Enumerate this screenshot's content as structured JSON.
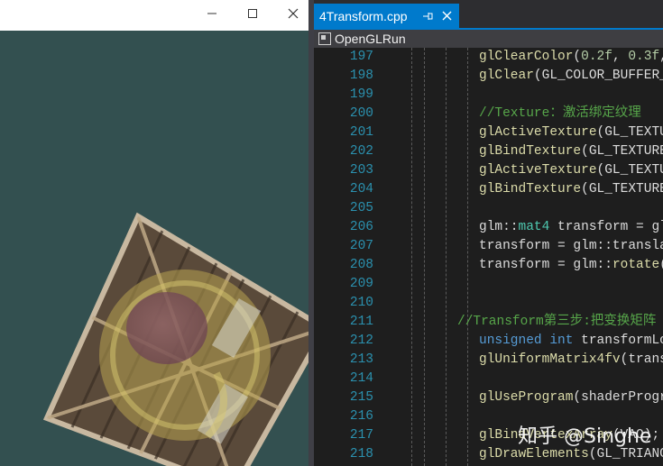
{
  "gl_window": {
    "title": "",
    "buttons": {
      "minimize": "—",
      "maximize": "☐",
      "close": "✕"
    },
    "background_color": "#335050"
  },
  "editor": {
    "tab": {
      "title": "4Transform.cpp",
      "pin": "⊸",
      "close": "✕"
    },
    "nav": {
      "project": "OpenGLRun"
    },
    "lines": [
      {
        "n": "197",
        "text": "glClearColor(0.2f, 0.3f,"
      },
      {
        "n": "198",
        "text": "glClear(GL_COLOR_BUFFER_"
      },
      {
        "n": "199",
        "text": ""
      },
      {
        "n": "200",
        "text": "//Texture：激活绑定纹理"
      },
      {
        "n": "201",
        "text": "glActiveTexture(GL_TEXTU"
      },
      {
        "n": "202",
        "text": "glBindTexture(GL_TEXTURE"
      },
      {
        "n": "203",
        "text": "glActiveTexture(GL_TEXTU"
      },
      {
        "n": "204",
        "text": "glBindTexture(GL_TEXTURE"
      },
      {
        "n": "205",
        "text": ""
      },
      {
        "n": "206",
        "text": "glm::mat4 transform = gl"
      },
      {
        "n": "207",
        "text": "transform = glm::transla"
      },
      {
        "n": "208",
        "text": "transform = glm::rotate("
      },
      {
        "n": "209",
        "text": ""
      },
      {
        "n": "210",
        "text": ""
      },
      {
        "n": "211",
        "text": "//Transform第三步:把变换矩阵"
      },
      {
        "n": "212",
        "text": "unsigned int transformLo"
      },
      {
        "n": "213",
        "text": "glUniformMatrix4fv(trans"
      },
      {
        "n": "214",
        "text": ""
      },
      {
        "n": "215",
        "text": "glUseProgram(shaderProgr"
      },
      {
        "n": "216",
        "text": ""
      },
      {
        "n": "217",
        "text": "glBindVertexArray(VAO);"
      },
      {
        "n": "218",
        "text": "glDrawElements(GL_TRIANG"
      }
    ],
    "watermark": "知乎 @Singhe"
  }
}
